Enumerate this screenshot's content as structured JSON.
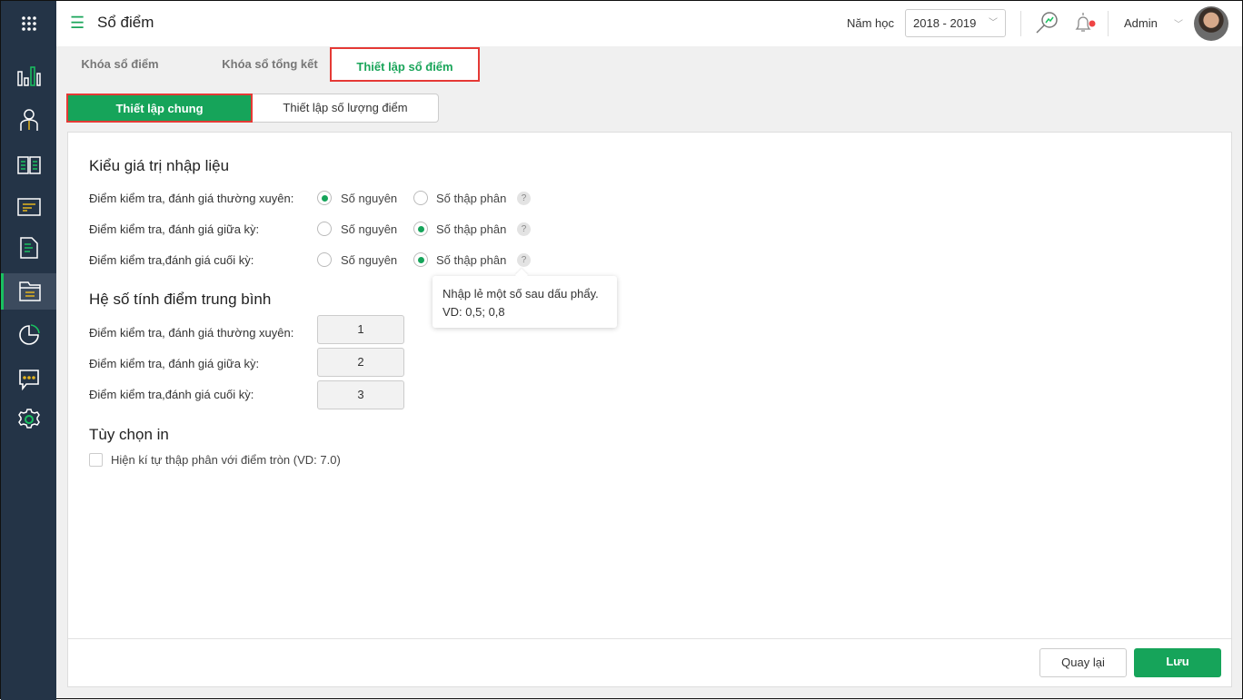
{
  "header": {
    "title": "Sổ điểm",
    "year_label": "Năm học",
    "year_value": "2018 - 2019",
    "user": "Admin"
  },
  "tabs": [
    {
      "label": "Khóa sổ điểm"
    },
    {
      "label": "Khóa sổ tổng kết"
    },
    {
      "label": "Thiết lập sổ điểm"
    }
  ],
  "subtabs": [
    {
      "label": "Thiết lập chung"
    },
    {
      "label": "Thiết lập số lượng điểm"
    }
  ],
  "section1": {
    "title": "Kiểu giá trị nhập liệu",
    "option_int": "Số nguyên",
    "option_dec": "Số thập phân",
    "help": "?",
    "rows": [
      {
        "label": "Điểm kiểm tra, đánh giá thường xuyên:",
        "selected": "int"
      },
      {
        "label": "Điểm kiểm tra, đánh giá giữa kỳ:",
        "selected": "dec"
      },
      {
        "label": "Điểm kiểm tra,đánh giá cuối kỳ:",
        "selected": "dec"
      }
    ]
  },
  "tooltip": {
    "line1": "Nhập lẻ một số sau dấu phẩy.",
    "line2": "VD: 0,5; 0,8"
  },
  "section2": {
    "title": "Hệ số tính điểm trung bình",
    "rows": [
      {
        "label": "Điểm kiểm tra, đánh giá thường xuyên:",
        "value": "1"
      },
      {
        "label": "Điểm kiểm tra, đánh giá giữa kỳ:",
        "value": "2"
      },
      {
        "label": "Điểm kiểm tra,đánh giá cuối kỳ:",
        "value": "3"
      }
    ]
  },
  "section3": {
    "title": "Tùy chọn in",
    "checkbox_label": "Hiện kí tự thập phân với điểm tròn (VD: 7.0)",
    "checked": false
  },
  "buttons": {
    "back": "Quay lại",
    "save": "Lưu"
  },
  "colors": {
    "accent": "#16a45a",
    "sidebar": "#243447",
    "highlight": "#e53935"
  }
}
